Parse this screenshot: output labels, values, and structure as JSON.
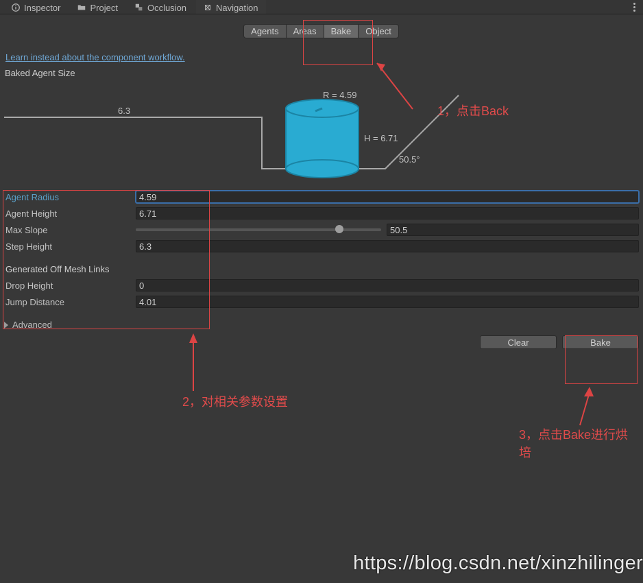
{
  "tabs": {
    "inspector": "Inspector",
    "project": "Project",
    "occlusion": "Occlusion",
    "navigation": "Navigation"
  },
  "subtabs": {
    "agents": "Agents",
    "areas": "Areas",
    "bake": "Bake",
    "object": "Object"
  },
  "link_text": "Learn instead about the component workflow.",
  "section_title": "Baked Agent Size",
  "diagram": {
    "r_label": "R = 4.59",
    "h_label": "H = 6.71",
    "step_label": "6.3",
    "slope_label": "50.5°"
  },
  "fields": {
    "agent_radius": {
      "label": "Agent Radius",
      "value": "4.59"
    },
    "agent_height": {
      "label": "Agent Height",
      "value": "6.71"
    },
    "max_slope": {
      "label": "Max Slope",
      "value": "50.5"
    },
    "step_height": {
      "label": "Step Height",
      "value": "6.3"
    }
  },
  "off_mesh": {
    "title": "Generated Off Mesh Links",
    "drop_height": {
      "label": "Drop Height",
      "value": "0"
    },
    "jump_distance": {
      "label": "Jump Distance",
      "value": "4.01"
    }
  },
  "advanced_label": "Advanced",
  "buttons": {
    "clear": "Clear",
    "bake": "Bake"
  },
  "annotations": {
    "a1": "1，点击Back",
    "a2": "2，对相关参数设置",
    "a3": "3，点击Bake进行烘培"
  },
  "watermark": "https://blog.csdn.net/xinzhilinger"
}
